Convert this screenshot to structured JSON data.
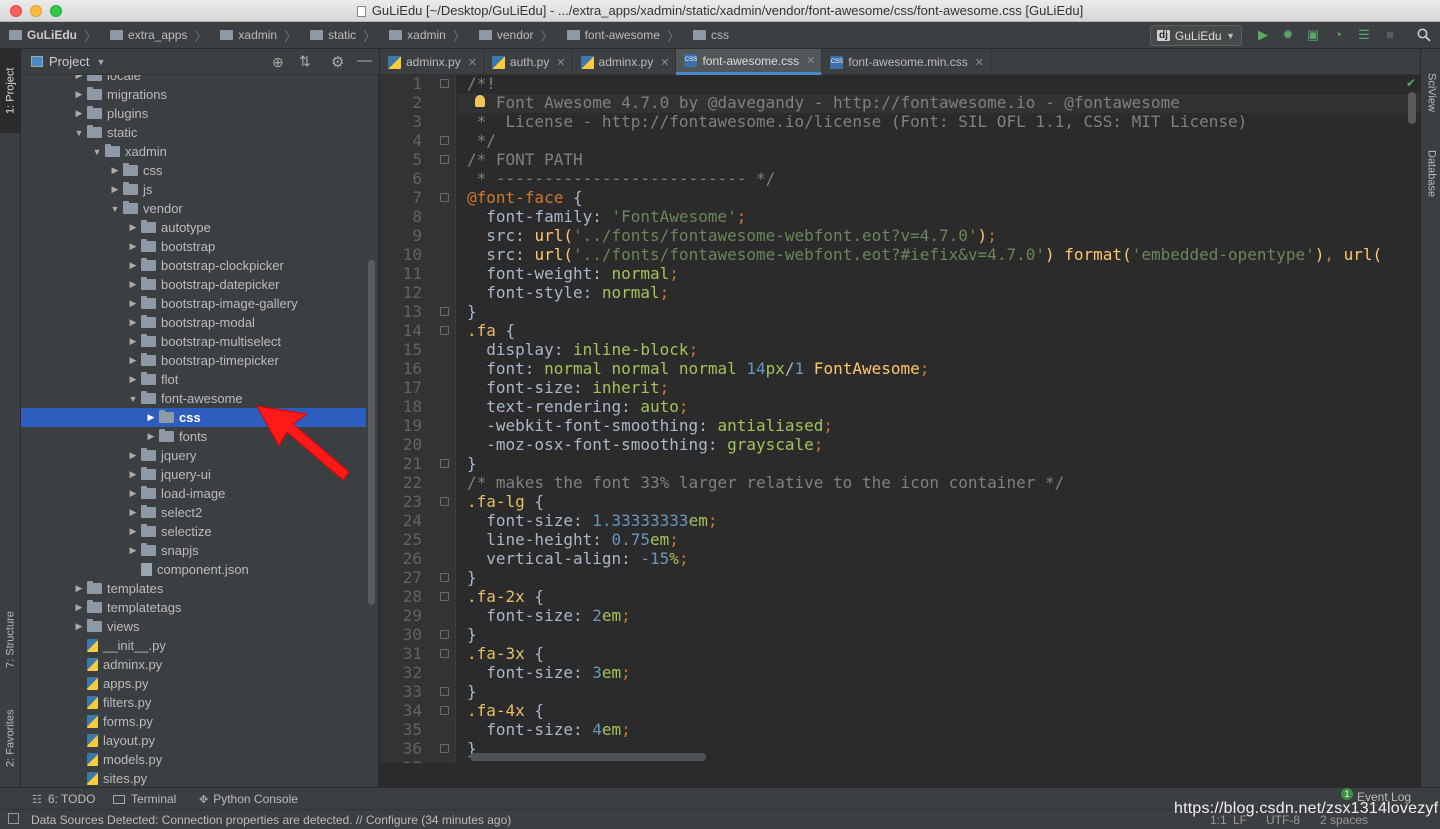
{
  "window": {
    "title": "GuLiEdu [~/Desktop/GuLiEdu] - .../extra_apps/xadmin/static/xadmin/vendor/font-awesome/css/font-awesome.css [GuLiEdu]"
  },
  "breadcrumb": [
    "GuLiEdu",
    "extra_apps",
    "xadmin",
    "static",
    "xadmin",
    "vendor",
    "font-awesome",
    "css"
  ],
  "toolbar": {
    "run_config": "GuLiEdu",
    "icons": [
      "run-icon",
      "debug-icon",
      "coverage-icon",
      "profile-icon",
      "concurrency-icon",
      "stop-icon",
      "search-icon"
    ]
  },
  "left_tool_tabs": [
    "1: Project",
    "7: Structure",
    "2: Favorites"
  ],
  "right_tool_tabs": [
    "SciView",
    "Database"
  ],
  "project_panel": {
    "title": "Project",
    "tree": [
      {
        "label": "locale",
        "depth": 3,
        "kind": "folder",
        "arrow": "collapsed"
      },
      {
        "label": "migrations",
        "depth": 3,
        "kind": "folder",
        "arrow": "collapsed"
      },
      {
        "label": "plugins",
        "depth": 3,
        "kind": "folder",
        "arrow": "collapsed"
      },
      {
        "label": "static",
        "depth": 3,
        "kind": "folder",
        "arrow": "expanded"
      },
      {
        "label": "xadmin",
        "depth": 4,
        "kind": "folder",
        "arrow": "expanded"
      },
      {
        "label": "css",
        "depth": 5,
        "kind": "folder",
        "arrow": "collapsed"
      },
      {
        "label": "js",
        "depth": 5,
        "kind": "folder",
        "arrow": "collapsed"
      },
      {
        "label": "vendor",
        "depth": 5,
        "kind": "folder",
        "arrow": "expanded"
      },
      {
        "label": "autotype",
        "depth": 6,
        "kind": "folder",
        "arrow": "collapsed"
      },
      {
        "label": "bootstrap",
        "depth": 6,
        "kind": "folder",
        "arrow": "collapsed"
      },
      {
        "label": "bootstrap-clockpicker",
        "depth": 6,
        "kind": "folder",
        "arrow": "collapsed"
      },
      {
        "label": "bootstrap-datepicker",
        "depth": 6,
        "kind": "folder",
        "arrow": "collapsed"
      },
      {
        "label": "bootstrap-image-gallery",
        "depth": 6,
        "kind": "folder",
        "arrow": "collapsed"
      },
      {
        "label": "bootstrap-modal",
        "depth": 6,
        "kind": "folder",
        "arrow": "collapsed"
      },
      {
        "label": "bootstrap-multiselect",
        "depth": 6,
        "kind": "folder",
        "arrow": "collapsed"
      },
      {
        "label": "bootstrap-timepicker",
        "depth": 6,
        "kind": "folder",
        "arrow": "collapsed"
      },
      {
        "label": "flot",
        "depth": 6,
        "kind": "folder",
        "arrow": "collapsed"
      },
      {
        "label": "font-awesome",
        "depth": 6,
        "kind": "folder",
        "arrow": "expanded"
      },
      {
        "label": "css",
        "depth": 7,
        "kind": "folder",
        "arrow": "collapsed",
        "selected": true
      },
      {
        "label": "fonts",
        "depth": 7,
        "kind": "folder",
        "arrow": "collapsed"
      },
      {
        "label": "jquery",
        "depth": 6,
        "kind": "folder",
        "arrow": "collapsed"
      },
      {
        "label": "jquery-ui",
        "depth": 6,
        "kind": "folder",
        "arrow": "collapsed"
      },
      {
        "label": "load-image",
        "depth": 6,
        "kind": "folder",
        "arrow": "collapsed"
      },
      {
        "label": "select2",
        "depth": 6,
        "kind": "folder",
        "arrow": "collapsed"
      },
      {
        "label": "selectize",
        "depth": 6,
        "kind": "folder",
        "arrow": "collapsed"
      },
      {
        "label": "snapjs",
        "depth": 6,
        "kind": "folder",
        "arrow": "collapsed"
      },
      {
        "label": "component.json",
        "depth": 6,
        "kind": "json",
        "arrow": "none"
      },
      {
        "label": "templates",
        "depth": 3,
        "kind": "folder",
        "arrow": "collapsed"
      },
      {
        "label": "templatetags",
        "depth": 3,
        "kind": "folder",
        "arrow": "collapsed"
      },
      {
        "label": "views",
        "depth": 3,
        "kind": "folder",
        "arrow": "collapsed"
      },
      {
        "label": "__init__.py",
        "depth": 3,
        "kind": "py",
        "arrow": "none"
      },
      {
        "label": "adminx.py",
        "depth": 3,
        "kind": "py",
        "arrow": "none"
      },
      {
        "label": "apps.py",
        "depth": 3,
        "kind": "py",
        "arrow": "none"
      },
      {
        "label": "filters.py",
        "depth": 3,
        "kind": "py",
        "arrow": "none"
      },
      {
        "label": "forms.py",
        "depth": 3,
        "kind": "py",
        "arrow": "none"
      },
      {
        "label": "layout.py",
        "depth": 3,
        "kind": "py",
        "arrow": "none"
      },
      {
        "label": "models.py",
        "depth": 3,
        "kind": "py",
        "arrow": "none"
      },
      {
        "label": "sites.py",
        "depth": 3,
        "kind": "py",
        "arrow": "none"
      }
    ]
  },
  "editor_tabs": [
    {
      "label": "adminx.py",
      "kind": "py",
      "active": false
    },
    {
      "label": "auth.py",
      "kind": "py",
      "active": false
    },
    {
      "label": "adminx.py",
      "kind": "py",
      "active": false
    },
    {
      "label": "font-awesome.css",
      "kind": "css",
      "active": true
    },
    {
      "label": "font-awesome.min.css",
      "kind": "css",
      "active": false
    }
  ],
  "code_lines": [
    [
      [
        "c-com",
        "/*!"
      ]
    ],
    [
      [
        "c-com",
        "   Font Awesome 4.7.0 by @davegandy - http://fontawesome.io - @fontawesome"
      ]
    ],
    [
      [
        "c-com",
        " *  License - http://fontawesome.io/license (Font: SIL OFL 1.1, CSS: MIT License)"
      ]
    ],
    [
      [
        "c-com",
        " */"
      ]
    ],
    [
      [
        "c-com",
        "/* FONT PATH"
      ]
    ],
    [
      [
        "c-com",
        " * -------------------------- */"
      ]
    ],
    [
      [
        "c-key",
        "@font-face"
      ],
      [
        "c-prop",
        " {"
      ]
    ],
    [
      [
        "c-prop",
        "  font-family: "
      ],
      [
        "c-str",
        "'FontAwesome'"
      ],
      [
        "c-punct",
        ";"
      ]
    ],
    [
      [
        "c-prop",
        "  src: "
      ],
      [
        "c-fn",
        "url("
      ],
      [
        "c-str",
        "'../fonts/fontawesome-webfont.eot?v=4.7.0'"
      ],
      [
        "c-fn",
        ")"
      ],
      [
        "c-punct",
        ";"
      ]
    ],
    [
      [
        "c-prop",
        "  src: "
      ],
      [
        "c-fn",
        "url("
      ],
      [
        "c-str",
        "'../fonts/fontawesome-webfont.eot?#iefix&v=4.7.0'"
      ],
      [
        "c-fn",
        ")"
      ],
      [
        "c-prop",
        " "
      ],
      [
        "c-fn",
        "format("
      ],
      [
        "c-str",
        "'embedded-opentype'"
      ],
      [
        "c-fn",
        ")"
      ],
      [
        "c-punct",
        ", "
      ],
      [
        "c-fn",
        "url("
      ]
    ],
    [
      [
        "c-prop",
        "  font-weight: "
      ],
      [
        "c-val",
        "normal"
      ],
      [
        "c-punct",
        ";"
      ]
    ],
    [
      [
        "c-prop",
        "  font-style: "
      ],
      [
        "c-val",
        "normal"
      ],
      [
        "c-punct",
        ";"
      ]
    ],
    [
      [
        "c-prop",
        "}"
      ]
    ],
    [
      [
        "c-sel",
        ".fa"
      ],
      [
        "c-prop",
        " {"
      ]
    ],
    [
      [
        "c-prop",
        "  display: "
      ],
      [
        "c-val",
        "inline-block"
      ],
      [
        "c-punct",
        ";"
      ]
    ],
    [
      [
        "c-prop",
        "  font: "
      ],
      [
        "c-val",
        "normal normal normal "
      ],
      [
        "c-num",
        "14"
      ],
      [
        "c-val",
        "px"
      ],
      [
        "c-prop",
        "/"
      ],
      [
        "c-num",
        "1"
      ],
      [
        "c-fn",
        " FontAwesome"
      ],
      [
        "c-punct",
        ";"
      ]
    ],
    [
      [
        "c-prop",
        "  font-size: "
      ],
      [
        "c-val",
        "inherit"
      ],
      [
        "c-punct",
        ";"
      ]
    ],
    [
      [
        "c-prop",
        "  text-rendering: "
      ],
      [
        "c-val",
        "auto"
      ],
      [
        "c-punct",
        ";"
      ]
    ],
    [
      [
        "c-prop",
        "  -webkit-font-smoothing: "
      ],
      [
        "c-val",
        "antialiased"
      ],
      [
        "c-punct",
        ";"
      ]
    ],
    [
      [
        "c-prop",
        "  -moz-osx-font-smoothing: "
      ],
      [
        "c-val",
        "grayscale"
      ],
      [
        "c-punct",
        ";"
      ]
    ],
    [
      [
        "c-prop",
        "}"
      ]
    ],
    [
      [
        "c-com",
        "/* makes the font 33% larger relative to the icon container */"
      ]
    ],
    [
      [
        "c-sel",
        ".fa-lg"
      ],
      [
        "c-prop",
        " {"
      ]
    ],
    [
      [
        "c-prop",
        "  font-size: "
      ],
      [
        "c-num",
        "1.33333333"
      ],
      [
        "c-val",
        "em"
      ],
      [
        "c-punct",
        ";"
      ]
    ],
    [
      [
        "c-prop",
        "  line-height: "
      ],
      [
        "c-num",
        "0.75"
      ],
      [
        "c-val",
        "em"
      ],
      [
        "c-punct",
        ";"
      ]
    ],
    [
      [
        "c-prop",
        "  vertical-align: "
      ],
      [
        "c-num",
        "-15"
      ],
      [
        "c-val",
        "%"
      ],
      [
        "c-punct",
        ";"
      ]
    ],
    [
      [
        "c-prop",
        "}"
      ]
    ],
    [
      [
        "c-sel",
        ".fa-2x"
      ],
      [
        "c-prop",
        " {"
      ]
    ],
    [
      [
        "c-prop",
        "  font-size: "
      ],
      [
        "c-num",
        "2"
      ],
      [
        "c-val",
        "em"
      ],
      [
        "c-punct",
        ";"
      ]
    ],
    [
      [
        "c-prop",
        "}"
      ]
    ],
    [
      [
        "c-sel",
        ".fa-3x"
      ],
      [
        "c-prop",
        " {"
      ]
    ],
    [
      [
        "c-prop",
        "  font-size: "
      ],
      [
        "c-num",
        "3"
      ],
      [
        "c-val",
        "em"
      ],
      [
        "c-punct",
        ";"
      ]
    ],
    [
      [
        "c-prop",
        "}"
      ]
    ],
    [
      [
        "c-sel",
        ".fa-4x"
      ],
      [
        "c-prop",
        " {"
      ]
    ],
    [
      [
        "c-prop",
        "  font-size: "
      ],
      [
        "c-num",
        "4"
      ],
      [
        "c-val",
        "em"
      ],
      [
        "c-punct",
        ";"
      ]
    ],
    [
      [
        "c-prop",
        "}"
      ]
    ],
    [
      [
        "c-prop",
        ""
      ]
    ]
  ],
  "bottom_tools": {
    "todo": "6: TODO",
    "terminal": "Terminal",
    "python_console": "Python Console",
    "event_log": "Event Log",
    "event_log_count": "1"
  },
  "status": {
    "message": "Data Sources Detected: Connection properties are detected. // Configure (34 minutes ago)",
    "position": "1:1",
    "line_sep": "LF",
    "encoding": "UTF-8",
    "indent": "2 spaces"
  },
  "watermark": "https://blog.csdn.net/zsx1314lovezyf",
  "colors": {
    "selection": "#2d5ebd",
    "annotation_arrow": "#ff1a1a",
    "editor_bg": "#2b2b2b",
    "panel_bg": "#3c3f41"
  }
}
